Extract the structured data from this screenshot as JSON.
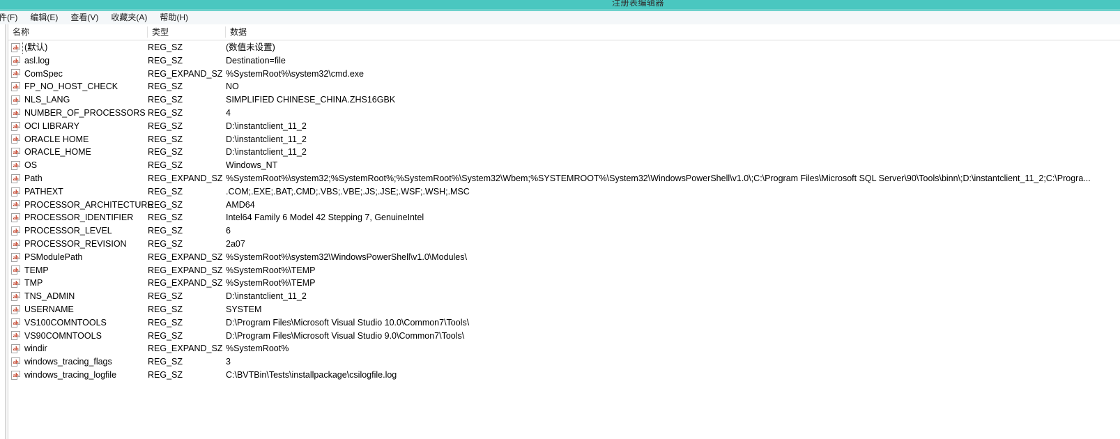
{
  "window": {
    "title": "注册表编辑器"
  },
  "menubar": {
    "items": [
      {
        "label": "件(F)",
        "name": "menu-file"
      },
      {
        "label": "编辑(E)",
        "name": "menu-edit"
      },
      {
        "label": "查看(V)",
        "name": "menu-view"
      },
      {
        "label": "收藏夹(A)",
        "name": "menu-favorites"
      },
      {
        "label": "帮助(H)",
        "name": "menu-help"
      }
    ]
  },
  "list": {
    "columns": [
      {
        "label": "名称"
      },
      {
        "label": "类型"
      },
      {
        "label": "数据"
      }
    ],
    "icon": "ab",
    "rows": [
      {
        "name": "(默认)",
        "type": "REG_SZ",
        "data": "(数值未设置)",
        "focused": true
      },
      {
        "name": "asl.log",
        "type": "REG_SZ",
        "data": "Destination=file",
        "focused": false
      },
      {
        "name": "ComSpec",
        "type": "REG_EXPAND_SZ",
        "data": "%SystemRoot%\\system32\\cmd.exe",
        "focused": false
      },
      {
        "name": "FP_NO_HOST_CHECK",
        "type": "REG_SZ",
        "data": "NO",
        "focused": false
      },
      {
        "name": "NLS_LANG",
        "type": "REG_SZ",
        "data": "SIMPLIFIED CHINESE_CHINA.ZHS16GBK",
        "focused": false
      },
      {
        "name": "NUMBER_OF_PROCESSORS",
        "type": "REG_SZ",
        "data": "4",
        "focused": false
      },
      {
        "name": "OCI LIBRARY",
        "type": "REG_SZ",
        "data": "D:\\instantclient_11_2",
        "focused": false
      },
      {
        "name": "ORACLE HOME",
        "type": "REG_SZ",
        "data": "D:\\instantclient_11_2",
        "focused": false
      },
      {
        "name": "ORACLE_HOME",
        "type": "REG_SZ",
        "data": "D:\\instantclient_11_2",
        "focused": false
      },
      {
        "name": "OS",
        "type": "REG_SZ",
        "data": "Windows_NT",
        "focused": false
      },
      {
        "name": "Path",
        "type": "REG_EXPAND_SZ",
        "data": "%SystemRoot%\\system32;%SystemRoot%;%SystemRoot%\\System32\\Wbem;%SYSTEMROOT%\\System32\\WindowsPowerShell\\v1.0\\;C:\\Program Files\\Microsoft SQL Server\\90\\Tools\\binn\\;D:\\instantclient_11_2;C:\\Progra...",
        "focused": false
      },
      {
        "name": "PATHEXT",
        "type": "REG_SZ",
        "data": ".COM;.EXE;.BAT;.CMD;.VBS;.VBE;.JS;.JSE;.WSF;.WSH;.MSC",
        "focused": false
      },
      {
        "name": "PROCESSOR_ARCHITECTURE",
        "type": "REG_SZ",
        "data": "AMD64",
        "focused": false
      },
      {
        "name": "PROCESSOR_IDENTIFIER",
        "type": "REG_SZ",
        "data": "Intel64 Family 6 Model 42 Stepping 7, GenuineIntel",
        "focused": false
      },
      {
        "name": "PROCESSOR_LEVEL",
        "type": "REG_SZ",
        "data": "6",
        "focused": false
      },
      {
        "name": "PROCESSOR_REVISION",
        "type": "REG_SZ",
        "data": "2a07",
        "focused": false
      },
      {
        "name": "PSModulePath",
        "type": "REG_EXPAND_SZ",
        "data": "%SystemRoot%\\system32\\WindowsPowerShell\\v1.0\\Modules\\",
        "focused": false
      },
      {
        "name": "TEMP",
        "type": "REG_EXPAND_SZ",
        "data": "%SystemRoot%\\TEMP",
        "focused": false
      },
      {
        "name": "TMP",
        "type": "REG_EXPAND_SZ",
        "data": "%SystemRoot%\\TEMP",
        "focused": false
      },
      {
        "name": "TNS_ADMIN",
        "type": "REG_SZ",
        "data": "D:\\instantclient_11_2",
        "focused": false
      },
      {
        "name": "USERNAME",
        "type": "REG_SZ",
        "data": "SYSTEM",
        "focused": false
      },
      {
        "name": "VS100COMNTOOLS",
        "type": "REG_SZ",
        "data": "D:\\Program Files\\Microsoft Visual Studio 10.0\\Common7\\Tools\\",
        "focused": false
      },
      {
        "name": "VS90COMNTOOLS",
        "type": "REG_SZ",
        "data": "D:\\Program Files\\Microsoft Visual Studio 9.0\\Common7\\Tools\\",
        "focused": false
      },
      {
        "name": "windir",
        "type": "REG_EXPAND_SZ",
        "data": "%SystemRoot%",
        "focused": false
      },
      {
        "name": "windows_tracing_flags",
        "type": "REG_SZ",
        "data": "3",
        "focused": false
      },
      {
        "name": "windows_tracing_logfile",
        "type": "REG_SZ",
        "data": "C:\\BVTBin\\Tests\\installpackage\\csilogfile.log",
        "focused": false
      }
    ]
  },
  "colors": {
    "titlebar": "#4ac7c0",
    "titlebar_underline": "#6ed2cc",
    "menubar": "#f4f7f9",
    "icon_text": "#c23b22"
  }
}
